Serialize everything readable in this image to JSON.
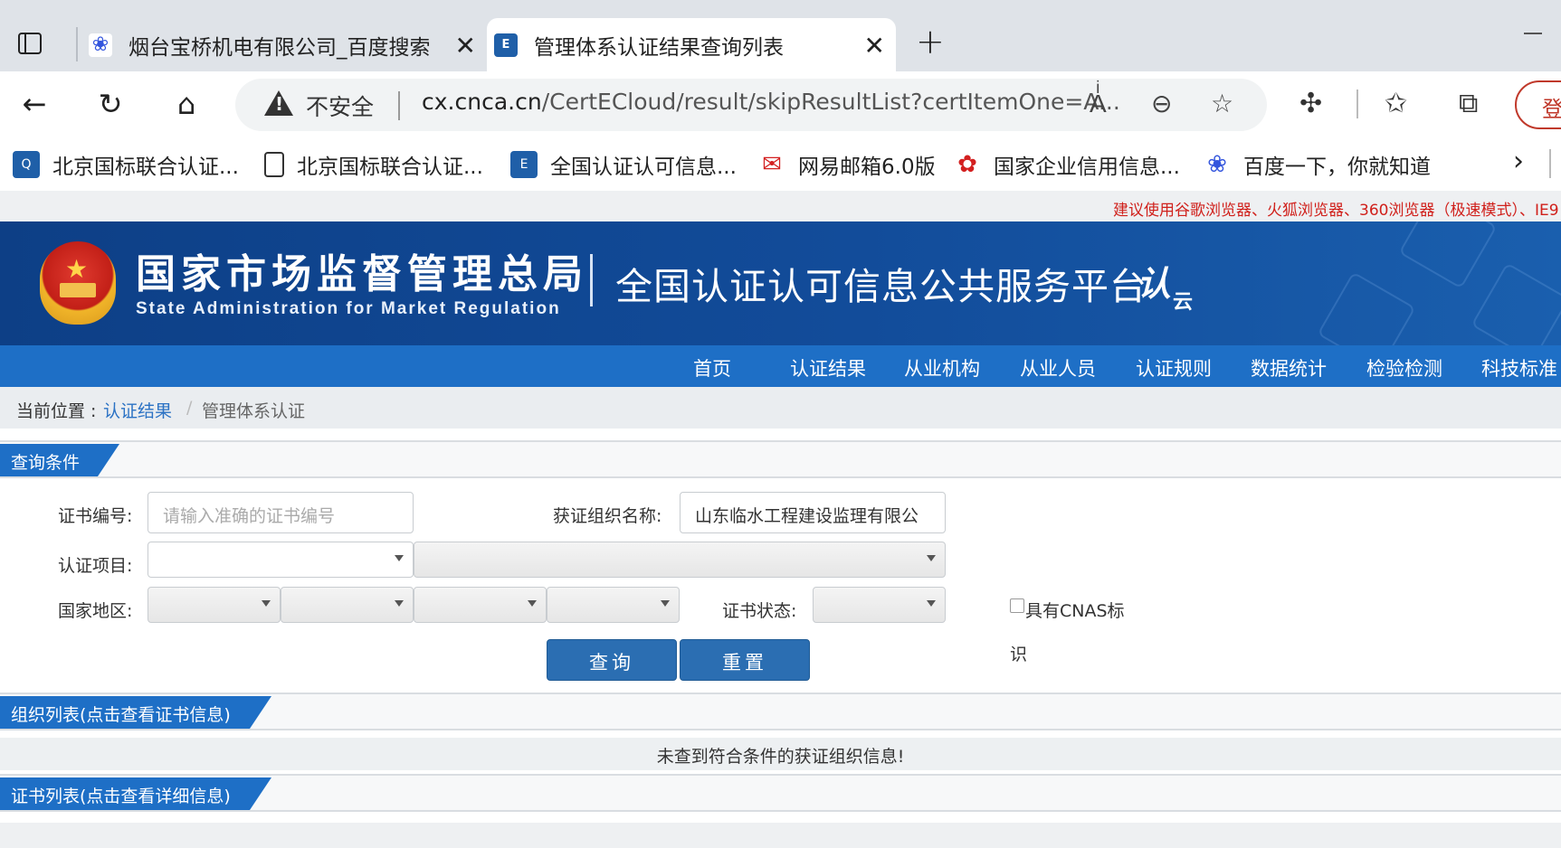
{
  "browser": {
    "tabs": [
      {
        "title": "烟台宝桥机电有限公司_百度搜索",
        "icon": "baidu-paw-icon",
        "active": false
      },
      {
        "title": "管理体系认证结果查询列表",
        "icon": "cnca-icon",
        "active": true
      }
    ],
    "address": {
      "security_label": "不安全",
      "url_host": "cx.cnca.cn",
      "url_path": "/CertECloud/result/skipResultList?certItemOne=A..."
    },
    "login_label": "登",
    "bookmarks": [
      {
        "label": "北京国标联合认证...",
        "icon": "cnca-icon"
      },
      {
        "label": "北京国标联合认证...",
        "icon": "document-icon"
      },
      {
        "label": "全国认证认可信息...",
        "icon": "cnca-icon"
      },
      {
        "label": "网易邮箱6.0版",
        "icon": "netease-mail-icon"
      },
      {
        "label": "国家企业信用信息...",
        "icon": "huawei-flower-icon"
      },
      {
        "label": "百度一下，你就知道",
        "icon": "baidu-paw-icon"
      }
    ]
  },
  "site": {
    "notice": "建议使用谷歌浏览器、火狐浏览器、360浏览器（极速模式）、IE9",
    "agency_cn": "国家市场监督管理总局",
    "agency_en": "State Administration  for  Market Regulation",
    "platform": "全国认证认可信息公共服务平台",
    "brand": "认",
    "brand_suffix": "云",
    "nav": [
      "首页",
      "认证结果",
      "从业机构",
      "从业人员",
      "认证规则",
      "数据统计",
      "检验检测",
      "科技标准"
    ],
    "breadcrumb": {
      "lead": "当前位置 : ",
      "link": "认证结果",
      "sep": "/",
      "current": "管理体系认证"
    },
    "query_section": "查询条件",
    "form": {
      "cert_no_label": "证书编号:",
      "cert_no_placeholder": "请输入准确的证书编号",
      "org_label": "获证组织名称:",
      "org_value": "山东临水工程建设监理有限公",
      "project_label": "认证项目:",
      "region_label": "国家地区:",
      "status_label": "证书状态:",
      "cnas_label_1": "具有CNAS标",
      "cnas_label_2": "识",
      "search_button": "查询",
      "reset_button": "重置"
    },
    "org_section": "组织列表(点击查看证书信息)",
    "org_empty": "未查到符合条件的获证组织信息!",
    "cert_section": "证书列表(点击查看详细信息)"
  },
  "colors": {
    "brand_blue": "#1e6fc6",
    "banner_blue": "#0d3f86",
    "button_blue": "#2b6eb2",
    "notice_red": "#d0201b",
    "link_blue": "#2b72c4"
  }
}
